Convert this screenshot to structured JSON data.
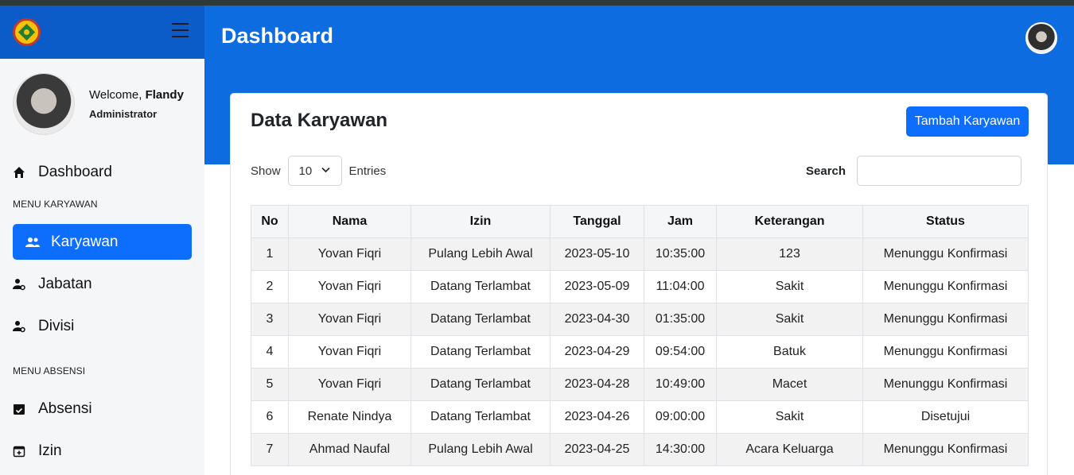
{
  "sidebar": {
    "welcome_prefix": "Welcome,",
    "user_name": "Flandy",
    "role": "Administrator",
    "dashboard": "Dashboard",
    "section_karyawan": "MENU KARYAWAN",
    "karyawan": "Karyawan",
    "jabatan": "Jabatan",
    "divisi": "Divisi",
    "section_absensi": "MENU ABSENSI",
    "absensi": "Absensi",
    "izin": "Izin"
  },
  "header": {
    "title": "Dashboard"
  },
  "card": {
    "title": "Data Karyawan",
    "add_button": "Tambah Karyawan",
    "show_label": "Show",
    "entries_value": "10",
    "entries_label": "Entries",
    "search_label": "Search",
    "search_value": ""
  },
  "table": {
    "columns": [
      "No",
      "Nama",
      "Izin",
      "Tanggal",
      "Jam",
      "Keterangan",
      "Status"
    ],
    "rows": [
      [
        "1",
        "Yovan Fiqri",
        "Pulang Lebih Awal",
        "2023-05-10",
        "10:35:00",
        "123",
        "Menunggu Konfirmasi"
      ],
      [
        "2",
        "Yovan Fiqri",
        "Datang Terlambat",
        "2023-05-09",
        "11:04:00",
        "Sakit",
        "Menunggu Konfirmasi"
      ],
      [
        "3",
        "Yovan Fiqri",
        "Datang Terlambat",
        "2023-04-30",
        "01:35:00",
        "Sakit",
        "Menunggu Konfirmasi"
      ],
      [
        "4",
        "Yovan Fiqri",
        "Datang Terlambat",
        "2023-04-29",
        "09:54:00",
        "Batuk",
        "Menunggu Konfirmasi"
      ],
      [
        "5",
        "Yovan Fiqri",
        "Datang Terlambat",
        "2023-04-28",
        "10:49:00",
        "Macet",
        "Menunggu Konfirmasi"
      ],
      [
        "6",
        "Renate Nindya",
        "Datang Terlambat",
        "2023-04-26",
        "09:00:00",
        "Sakit",
        "Disetujui"
      ],
      [
        "7",
        "Ahmad Naufal",
        "Pulang Lebih Awal",
        "2023-04-25",
        "14:30:00",
        "Acara Keluarga",
        "Menunggu Konfirmasi"
      ]
    ]
  },
  "colors": {
    "primary": "#0d6efd",
    "header": "#0d6ce0",
    "sidebar_head": "#0b5bc8"
  }
}
